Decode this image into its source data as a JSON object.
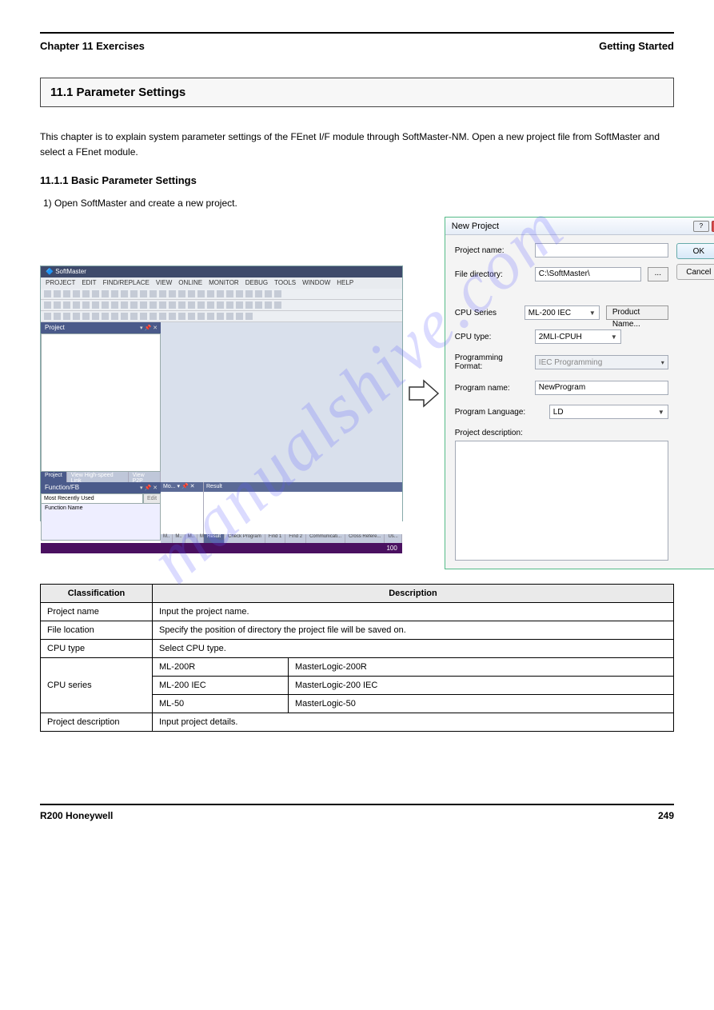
{
  "header": {
    "left": "Chapter 11  Exercises",
    "right": "Getting Started"
  },
  "section": "11.1 Parameter Settings",
  "intro": "This chapter is to explain system parameter settings of the FEnet I/F module through SoftMaster-NM. Open a new project file from SoftMaster and select a FEnet module.",
  "subhead_basic": "11.1.1 Basic Parameter Settings",
  "step1": "1) Open SoftMaster and create a new project.",
  "softmaster": {
    "title": "SoftMaster",
    "menus": [
      "PROJECT",
      "EDIT",
      "FIND/REPLACE",
      "VIEW",
      "ONLINE",
      "MONITOR",
      "DEBUG",
      "TOOLS",
      "WINDOW",
      "HELP"
    ],
    "panel_project": "Project",
    "tabs_left": [
      "Project",
      "View High-speed Link",
      "View P2P"
    ],
    "panel_func": "Function/FB",
    "func_dd": "Most Recently Used",
    "func_edit": "Edit",
    "func_name": "Function Name",
    "mon_head": "Mo...",
    "montabs": [
      "M..",
      "M..",
      "M..",
      "M.."
    ],
    "res_head": "Result",
    "restabs": [
      "Result",
      "Check Program",
      "Find 1",
      "Find 2",
      "Communicati...",
      "Cross Refere...",
      "Us..."
    ],
    "status_right": "100"
  },
  "newproj": {
    "title": "New Project",
    "labels": {
      "project_name": "Project name:",
      "file_dir": "File directory:",
      "cpu_series": "CPU Series",
      "cpu_type": "CPU type:",
      "prog_fmt1": "Programming",
      "prog_fmt2": "Format:",
      "prog_name": "Program name:",
      "prog_lang": "Program Language:",
      "proj_desc": "Project description:"
    },
    "values": {
      "file_dir": "C:\\SoftMaster\\",
      "cpu_series": "ML-200 IEC",
      "cpu_type": "2MLI-CPUH",
      "prog_fmt": "IEC Programming",
      "prog_name": "NewProgram",
      "prog_lang": "LD"
    },
    "buttons": {
      "ok": "OK",
      "cancel": "Cancel",
      "dots": "...",
      "product": "Product Name..."
    }
  },
  "watermark": "manualshive.com",
  "table": {
    "hdr": [
      "Classification",
      "Description"
    ],
    "rows": [
      {
        "c1": "Project name",
        "c2": "Input the project name."
      },
      {
        "c1": "File location",
        "c2": "Specify the position of directory the project file will be saved on."
      },
      {
        "c1": "CPU type",
        "c2": "Select CPU type."
      }
    ],
    "cpu_series_label": "CPU series",
    "cpu_series": [
      {
        "c2": "ML-200R",
        "c3": "MasterLogic-200R"
      },
      {
        "c2": "ML-200 IEC",
        "c3": "MasterLogic-200 IEC"
      },
      {
        "c2": "ML-50",
        "c3": "MasterLogic-50"
      }
    ],
    "desc": {
      "c1": "Project description",
      "c2": "Input project details."
    }
  },
  "footer": {
    "left": "R200  Honeywell",
    "right": "249"
  }
}
